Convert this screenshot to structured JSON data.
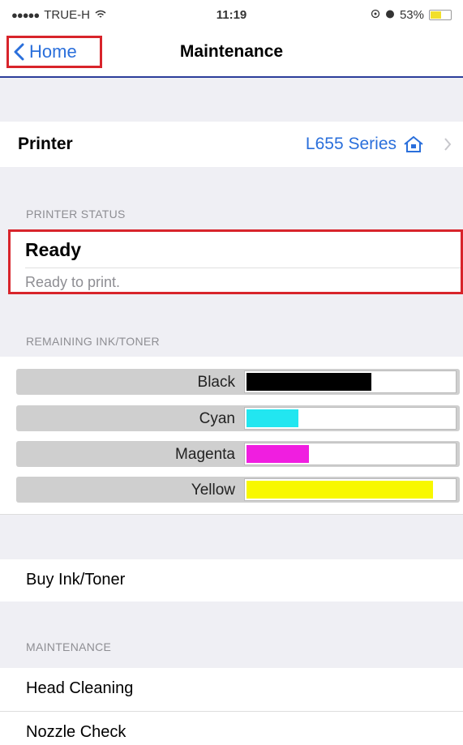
{
  "status_bar": {
    "carrier": "TRUE-H",
    "time": "11:19",
    "battery": "53%",
    "battery_level": 0.53
  },
  "nav": {
    "back_label": "Home",
    "title": "Maintenance"
  },
  "printer": {
    "label": "Printer",
    "value": "L655 Series"
  },
  "status": {
    "header": "PRINTER STATUS",
    "title": "Ready",
    "detail": "Ready to print."
  },
  "ink": {
    "header": "REMAINING INK/TONER",
    "items": [
      {
        "label": "Black",
        "level": 0.6,
        "color": "#000000"
      },
      {
        "label": "Cyan",
        "level": 0.25,
        "color": "#22e6f0"
      },
      {
        "label": "Magenta",
        "level": 0.3,
        "color": "#f01ee0"
      },
      {
        "label": "Yellow",
        "level": 0.9,
        "color": "#f8f800"
      }
    ]
  },
  "buy": {
    "label": "Buy Ink/Toner"
  },
  "maintenance": {
    "header": "MAINTENANCE",
    "items": [
      "Head Cleaning",
      "Nozzle Check"
    ]
  }
}
